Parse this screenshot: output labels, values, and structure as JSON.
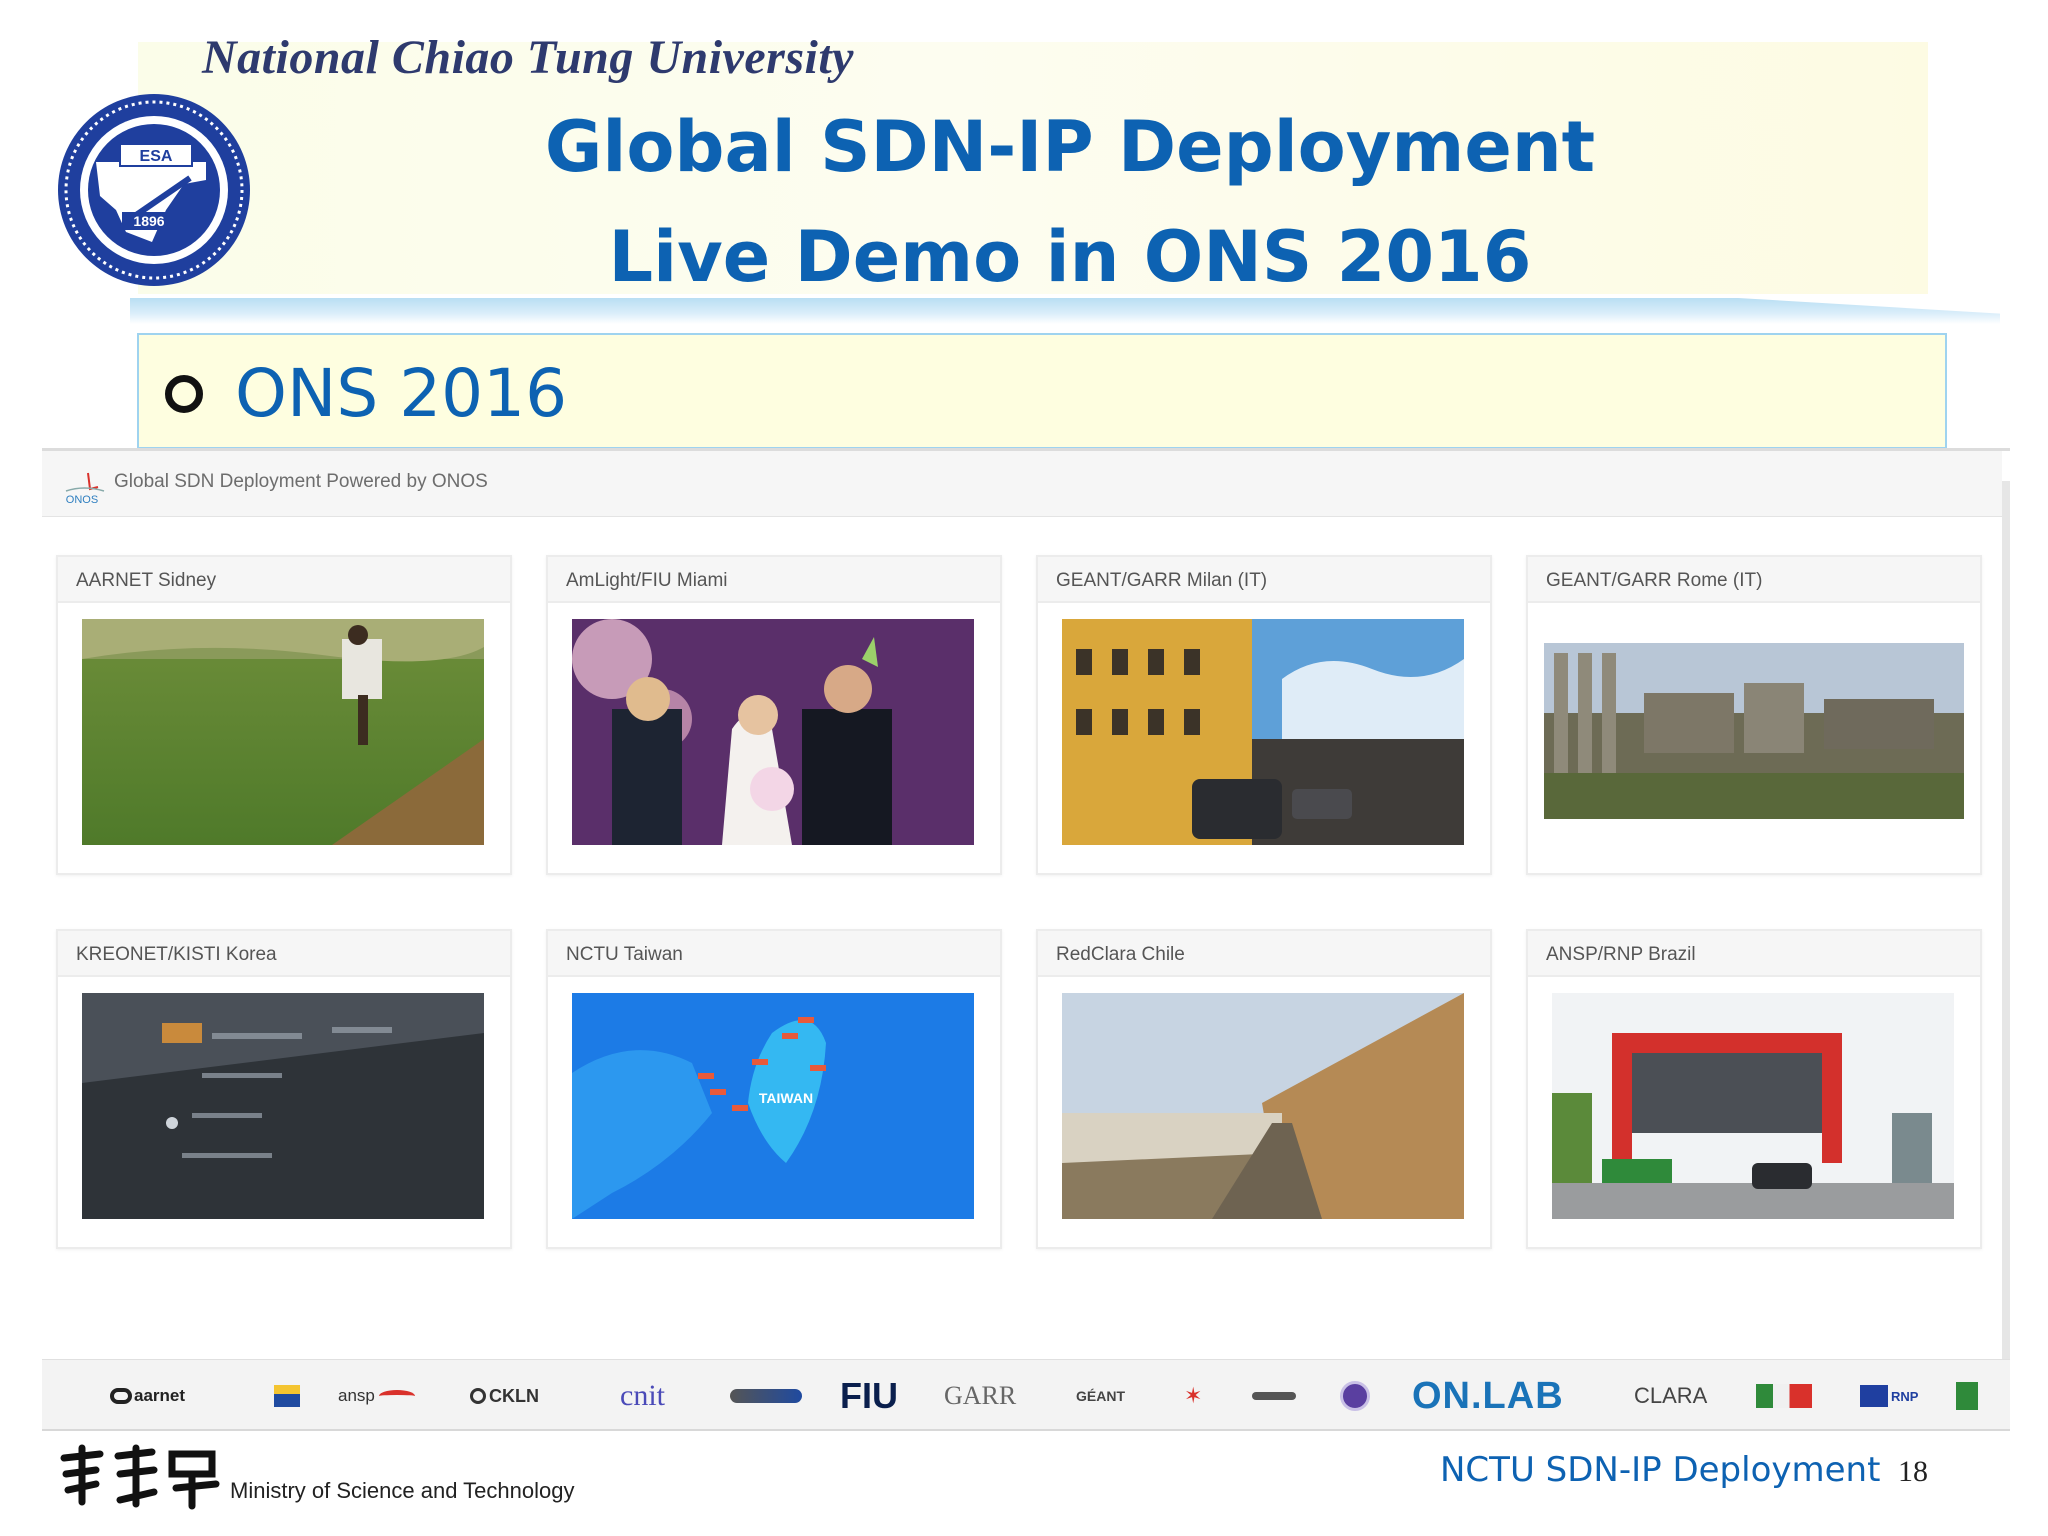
{
  "header": {
    "university": "National Chiao Tung University",
    "seal_year": "1896",
    "seal_letters": "ESA",
    "title_line1": "Global SDN-IP Deployment",
    "title_line2": "Live Demo in ONS 2016"
  },
  "bullet": {
    "text": "ONS 2016"
  },
  "screenshot": {
    "logo_text": "ONOS",
    "app_title": "Global SDN Deployment Powered by ONOS",
    "cards": [
      {
        "label": "AARNET Sidney",
        "scene": "grass-field-person-icon"
      },
      {
        "label": "AmLight/FIU Miami",
        "scene": "wedding-video-icon"
      },
      {
        "label": "GEANT/GARR Milan (IT)",
        "scene": "city-street-icon"
      },
      {
        "label": "GEANT/GARR Rome (IT)",
        "scene": "roman-ruins-icon"
      },
      {
        "label": "KREONET/KISTI Korea",
        "scene": "device-panel-icon"
      },
      {
        "label": "NCTU Taiwan",
        "scene": "taiwan-map-icon",
        "map_label": "TAIWAN"
      },
      {
        "label": "RedClara Chile",
        "scene": "coastal-road-icon"
      },
      {
        "label": "ANSP/RNP Brazil",
        "scene": "museum-building-icon"
      }
    ],
    "sponsors": [
      "aarnet",
      "ansp",
      "CKLN",
      "cnit",
      "FIU",
      "GARR",
      "GÉANT",
      "ON.LAB",
      "CLARA",
      "RNP"
    ]
  },
  "colors": {
    "title_blue": "#0d62b2",
    "bullet_box": "#fefee0",
    "onlab_blue": "#1a73b8",
    "onlab_red": "#d9312b"
  },
  "footer": {
    "ministry": "Ministry of Science and Technology",
    "deck_title": "NCTU SDN-IP Deployment",
    "page": "18"
  }
}
